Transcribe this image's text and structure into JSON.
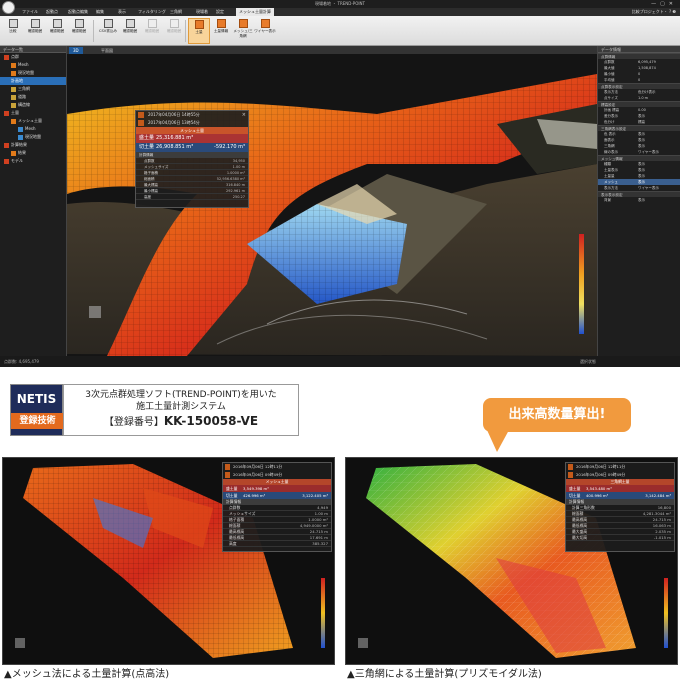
{
  "app": {
    "title": "現場着地 ・ TREND-POINT",
    "menu": [
      "ファイル",
      "起動点",
      "起動点編集",
      "編集",
      "表示",
      "フィルタリング",
      "三角網",
      "現場着",
      "設定",
      "メッシュ土量計算"
    ],
    "menu_active": "メッシュ土量計算",
    "menu_right": "比較プロジェクト・ ? ❷",
    "ribbon": [
      {
        "label": "比較",
        "state": "normal"
      },
      {
        "label": "確認範囲",
        "state": "normal"
      },
      {
        "label": "確認範囲",
        "state": "normal"
      },
      {
        "label": "確認範囲",
        "state": "normal"
      },
      {
        "label": "CSV書込み",
        "state": "normal"
      },
      {
        "label": "確認範囲",
        "state": "normal"
      },
      {
        "label": "確認範囲",
        "state": "disabled"
      },
      {
        "label": "確認範囲",
        "state": "disabled"
      },
      {
        "label": "土量",
        "state": "selected"
      },
      {
        "label": "土量情報",
        "state": "normal"
      },
      {
        "label": "メッシュ/三角網",
        "state": "normal"
      },
      {
        "label": "ワイヤー表示",
        "state": "normal"
      }
    ],
    "left_panel_title": "データ一覧",
    "tree": [
      {
        "label": "点群",
        "level": 0,
        "color": "#d04020"
      },
      {
        "label": "Mesh",
        "level": 1,
        "color": "#e07a1a"
      },
      {
        "label": "現況地盤",
        "level": 1,
        "color": "#e07a1a"
      },
      {
        "label": "計画地",
        "level": 0,
        "color": "#2a6fb8",
        "selected": true
      },
      {
        "label": "三角網",
        "level": 1,
        "color": "#c9a33a"
      },
      {
        "label": "道路",
        "level": 1,
        "color": "#c9a33a"
      },
      {
        "label": "構造線",
        "level": 1,
        "color": "#c9a33a"
      },
      {
        "label": "土量",
        "level": 0,
        "color": "#d04020"
      },
      {
        "label": "メッシュ土量",
        "level": 1,
        "color": "#e07a1a"
      },
      {
        "label": "Mesh",
        "level": 2,
        "color": "#3a8ad0"
      },
      {
        "label": "現況地盤",
        "level": 2,
        "color": "#3a8ad0"
      },
      {
        "label": "計算結果",
        "level": 0,
        "color": "#d04020"
      },
      {
        "label": "結果",
        "level": 1,
        "color": "#e07a1a"
      },
      {
        "label": "モデル",
        "level": 0,
        "color": "#d04020"
      }
    ],
    "view_tabs": [
      "3D",
      "平面図"
    ],
    "view_tab_active": "3D",
    "info": {
      "row1": "2017年04月06日 14時55分",
      "row2": "2017年04月06日 13時54分",
      "title": "メッシュ土量",
      "cut_label": "盛土量",
      "cut_value": "25,316.881 m³",
      "fill_label": "切土量",
      "fill_value": "26,908.851 m³",
      "diff_value": "-592.170 m³",
      "section": "計算情報",
      "rows": [
        {
          "k": "点群数",
          "v": "34,950"
        },
        {
          "k": "メッシュサイズ",
          "v": "1.00 m"
        },
        {
          "k": "格子面積",
          "v": "1.0000 m²"
        },
        {
          "k": "総面積",
          "v": "52,956.6380 m²"
        },
        {
          "k": "最大標高",
          "v": "316.840 m"
        },
        {
          "k": "最小標高",
          "v": "292.961 m"
        },
        {
          "k": "高度",
          "v": "250.27"
        }
      ]
    },
    "right_panel_title": "データ情報",
    "right_sections": [
      {
        "title": "点群情報",
        "rows": [
          {
            "k": "点群数",
            "v": "6,095,479"
          },
          {
            "k": "最大値",
            "v": "1,508,874"
          },
          {
            "k": "最小値",
            "v": "0"
          },
          {
            "k": "平均値",
            "v": "0"
          }
        ]
      },
      {
        "title": "点群表示設定",
        "rows": [
          {
            "k": "表示方法",
            "v": "色分け表示"
          },
          {
            "k": "点サイズ",
            "v": "1.0 m"
          }
        ]
      },
      {
        "title": "標高設定",
        "rows": [
          {
            "k": "計画 標高",
            "v": "0.00"
          },
          {
            "k": "差分表示",
            "v": "表示"
          },
          {
            "k": "色分け",
            "v": "標高"
          }
        ]
      },
      {
        "title": "三角網表示設定",
        "rows": [
          {
            "k": "色 表示",
            "v": "表示"
          },
          {
            "k": "面表示",
            "v": "表示"
          },
          {
            "k": "三角網",
            "v": "表示"
          },
          {
            "k": "線の表示",
            "v": "ワイヤー表示"
          }
        ]
      },
      {
        "title": "メッシュ情報",
        "rows": [
          {
            "k": "種類",
            "v": "表示"
          },
          {
            "k": "土量表示",
            "v": "表示"
          },
          {
            "k": "土量量",
            "v": "表示"
          },
          {
            "k": "メッシュ",
            "v": "表示",
            "hl": true
          },
          {
            "k": "表示方法",
            "v": "ワイヤー表示"
          }
        ]
      },
      {
        "title": "表示表示設定",
        "rows": [
          {
            "k": "背景",
            "v": "表示"
          }
        ]
      }
    ],
    "status_left": "点群数: 4,695,479",
    "status_right": "選択状態"
  },
  "netis": {
    "line1": "NETIS",
    "line2": "登録技術"
  },
  "tagline": {
    "line1": "3次元点群処理ソフト(TREND-POINT)を用いた",
    "line2": "施工土量計測システム",
    "line3_prefix": "【登録番号】",
    "line3_code": "KK-150058-VE"
  },
  "bubble": "出来高数量算出!",
  "shot_left": {
    "row1": "2016年09月06日 12時11分",
    "row2": "2016年09月06日 09時49分",
    "title": "メッシュ土量",
    "cut_label": "盛土量",
    "cut_value": "3,549.398 m³",
    "fill_label": "切土量",
    "fill_value": "426.996 m³",
    "diff_value": "3,122.405 m³",
    "section": "計算情報",
    "rows": [
      {
        "k": "点群数",
        "v": "4,949"
      },
      {
        "k": "メッシュサイズ",
        "v": "1.00 m"
      },
      {
        "k": "格子面積",
        "v": "1.0000 m²"
      },
      {
        "k": "総面積",
        "v": "4,949.0000 m²"
      },
      {
        "k": "最高標高",
        "v": "24.715 m"
      },
      {
        "k": "最低標高",
        "v": "17.691 m"
      },
      {
        "k": "高度",
        "v": "385.327"
      }
    ],
    "caption": "▲メッシュ法による土量計算(点高法)"
  },
  "shot_right": {
    "row1": "2016年09月06日 12時11分",
    "row2": "2016年09月06日 09時49分",
    "title": "三角網土量",
    "cut_label": "盛土量",
    "cut_value": "3,543.480 m³",
    "fill_label": "切土量",
    "fill_value": "400.996 m³",
    "diff_value": "3,142.484 m³",
    "section": "計算情報",
    "rows": [
      {
        "k": "計算三角形数",
        "v": "16,800"
      },
      {
        "k": "総面積",
        "v": "4,281.3044 m²"
      },
      {
        "k": "最高標高",
        "v": "24.715 m"
      },
      {
        "k": "最低標高",
        "v": "16.063 m"
      },
      {
        "k": "最大盛高",
        "v": "2.035 m"
      },
      {
        "k": "最大切高",
        "v": "-1.015 m"
      }
    ],
    "caption": "▲三角網による土量計算(プリズモイダル法)"
  }
}
